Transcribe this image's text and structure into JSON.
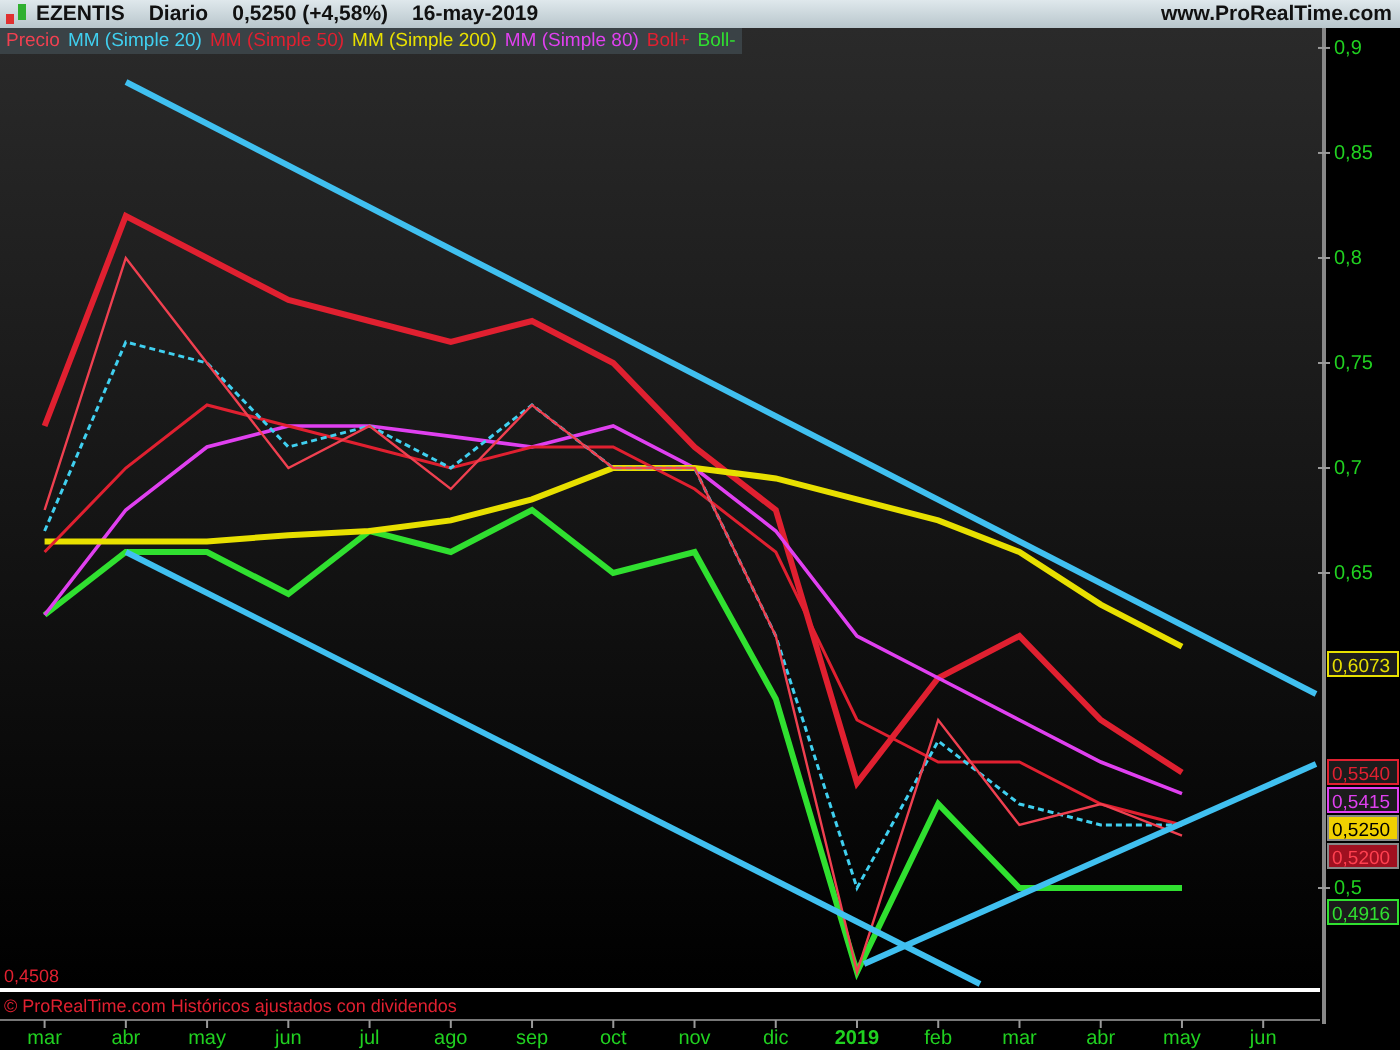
{
  "header": {
    "symbol": "EZENTIS",
    "period": "Diario",
    "price": "0,5250 (+4,58%)",
    "date": "16-may-2019",
    "site": "www.ProRealTime.com"
  },
  "chart": {
    "footer": "© ProRealTime.com  Históricos ajustados con dividendos",
    "low_label": "0,4508",
    "chart_data": {
      "type": "line",
      "categories": [
        "mar",
        "abr",
        "may",
        "jun",
        "jul",
        "ago",
        "sep",
        "oct",
        "nov",
        "dic",
        "2019",
        "feb",
        "mar",
        "abr",
        "may",
        "jun"
      ],
      "ylim": [
        0.4524,
        0.9095
      ],
      "yticks": [
        {
          "value": 0.9,
          "label": "0,9"
        },
        {
          "value": 0.85,
          "label": "0,85"
        },
        {
          "value": 0.8,
          "label": "0,8"
        },
        {
          "value": 0.75,
          "label": "0,75"
        },
        {
          "value": 0.7,
          "label": "0,7"
        },
        {
          "value": 0.65,
          "label": "0,65"
        },
        {
          "value": 0.5,
          "label": "0,5"
        }
      ],
      "series": [
        {
          "name": "Precio",
          "color": "#f04050",
          "values": [
            0.68,
            0.8,
            0.75,
            0.7,
            0.72,
            0.69,
            0.73,
            0.7,
            0.7,
            0.62,
            0.46,
            0.58,
            0.53,
            0.54,
            0.525,
            null
          ]
        },
        {
          "name": "MM (Simple 20)",
          "color": "#40d0f0",
          "line_style": "dashed",
          "values": [
            0.67,
            0.76,
            0.75,
            0.71,
            0.72,
            0.7,
            0.73,
            0.7,
            0.7,
            0.62,
            0.5,
            0.57,
            0.54,
            0.53,
            0.53,
            null
          ]
        },
        {
          "name": "MM (Simple 50)",
          "color": "#e02030",
          "values": [
            0.66,
            0.7,
            0.73,
            0.72,
            0.71,
            0.7,
            0.71,
            0.71,
            0.69,
            0.66,
            0.58,
            0.56,
            0.56,
            0.54,
            0.53,
            null
          ]
        },
        {
          "name": "MM (Simple 200)",
          "color": "#e8e000",
          "values": [
            0.665,
            0.665,
            0.665,
            0.668,
            0.67,
            0.675,
            0.685,
            0.7,
            0.7,
            0.695,
            0.685,
            0.675,
            0.66,
            0.635,
            0.615,
            null
          ]
        },
        {
          "name": "MM (Simple 80)",
          "color": "#e040f0",
          "values": [
            0.63,
            0.68,
            0.71,
            0.72,
            0.72,
            0.715,
            0.71,
            0.72,
            0.7,
            0.67,
            0.62,
            0.6,
            0.58,
            0.56,
            0.545,
            null
          ]
        },
        {
          "name": "Boll+",
          "color": "#e02030",
          "values": [
            0.72,
            0.82,
            0.8,
            0.78,
            0.77,
            0.76,
            0.77,
            0.75,
            0.71,
            0.68,
            0.55,
            0.6,
            0.62,
            0.58,
            0.555,
            null
          ]
        },
        {
          "name": "Boll-",
          "color": "#30e030",
          "values": [
            0.63,
            0.66,
            0.66,
            0.64,
            0.67,
            0.66,
            0.68,
            0.65,
            0.66,
            0.59,
            0.46,
            0.54,
            0.5,
            0.5,
            0.5,
            null
          ]
        }
      ]
    }
  },
  "price_tags": [
    {
      "label": "0,6073",
      "color": "#e8e000",
      "kind": "outline"
    },
    {
      "label": "0,5540",
      "color": "#e02030",
      "kind": "outline"
    },
    {
      "label": "0,5415",
      "color": "#e040f0",
      "kind": "outline"
    },
    {
      "label": "0,5250",
      "color": "#f0d000",
      "kind": "filled"
    },
    {
      "label": "0,5200",
      "color": "#a01020",
      "kind": "filled"
    },
    {
      "label": "0,4916",
      "color": "#30e030",
      "kind": "outline"
    }
  ]
}
